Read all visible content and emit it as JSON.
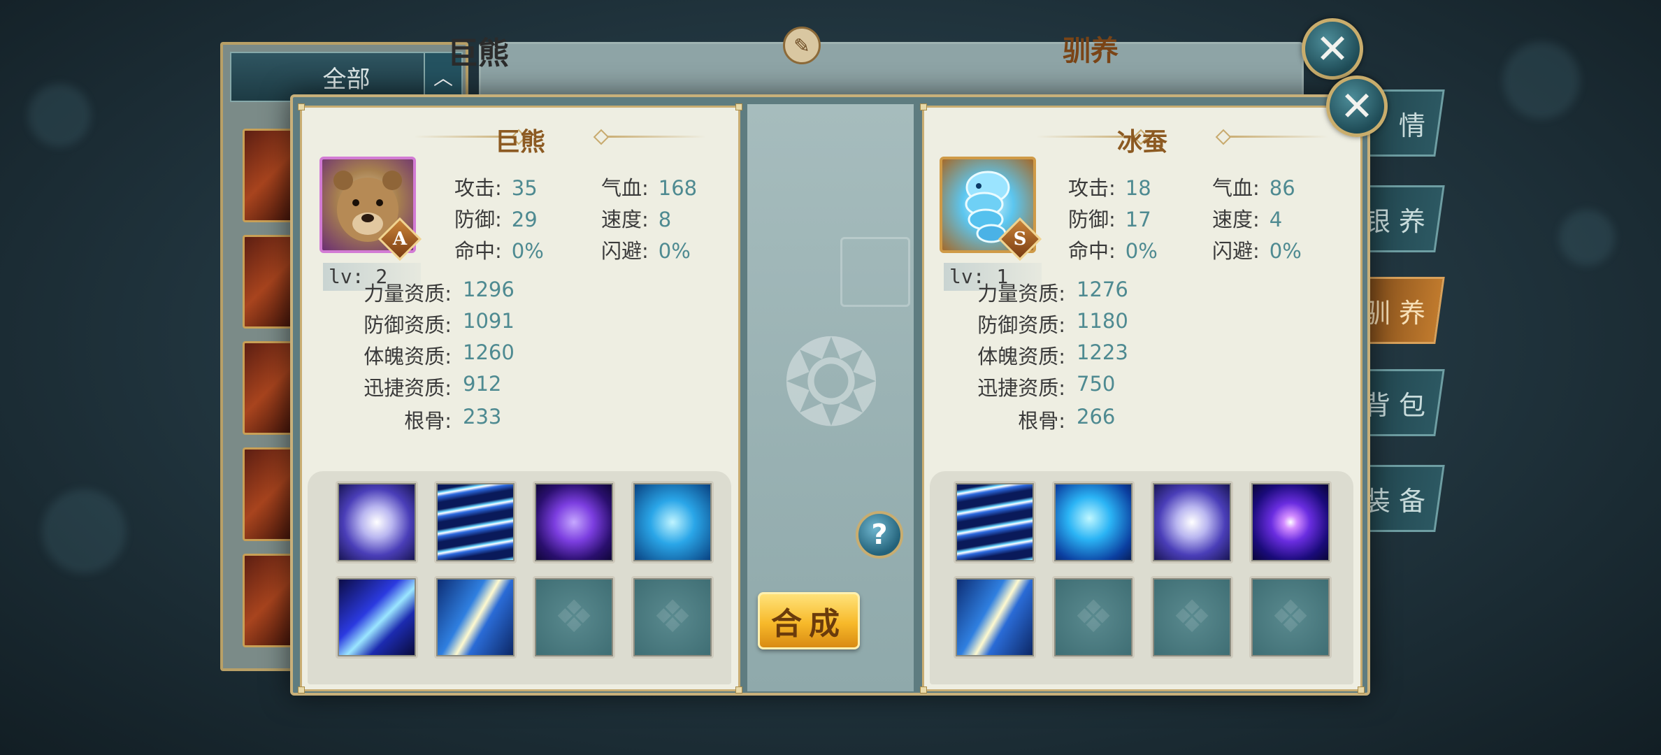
{
  "background_window": {
    "filter_label": "全部",
    "filter_arrow": "︿",
    "center_title": "巨熊",
    "train_title": "驯养",
    "side_tabs": [
      "情",
      "银 养",
      "驯 养",
      "背 包",
      "装 备"
    ]
  },
  "close_label": "✕",
  "left_pet": {
    "name": "巨熊",
    "grade": "A",
    "level": "lv: 2",
    "stats": {
      "attack_label": "攻击:",
      "attack": "35",
      "hp_label": "气血:",
      "hp": "168",
      "defense_label": "防御:",
      "defense": "29",
      "speed_label": "速度:",
      "speed": "8",
      "hit_label": "命中:",
      "hit": "0%",
      "dodge_label": "闪避:",
      "dodge": "0%"
    },
    "aptitudes": {
      "strength_label": "力量资质:",
      "strength": "1296",
      "defense_label": "防御资质:",
      "defense": "1091",
      "constitution_label": "体魄资质:",
      "constitution": "1260",
      "agility_label": "迅捷资质:",
      "agility": "912",
      "root_label": "根骨:",
      "root": "233"
    },
    "skills": [
      "orb",
      "beams",
      "pillar",
      "chain",
      "claw",
      "lightning",
      "empty",
      "empty"
    ]
  },
  "right_pet": {
    "name": "冰蚕",
    "grade": "S",
    "level": "lv: 1",
    "stats": {
      "attack_label": "攻击:",
      "attack": "18",
      "hp_label": "气血:",
      "hp": "86",
      "defense_label": "防御:",
      "defense": "17",
      "speed_label": "速度:",
      "speed": "4",
      "hit_label": "命中:",
      "hit": "0%",
      "dodge_label": "闪避:",
      "dodge": "0%"
    },
    "aptitudes": {
      "strength_label": "力量资质:",
      "strength": "1276",
      "defense_label": "防御资质:",
      "defense": "1180",
      "constitution_label": "体魄资质:",
      "constitution": "1223",
      "agility_label": "迅捷资质:",
      "agility": "750",
      "root_label": "根骨:",
      "root": "266"
    },
    "skills": [
      "beams",
      "wolf",
      "orb",
      "vortex",
      "lightning",
      "empty",
      "empty",
      "empty"
    ]
  },
  "help_label": "?",
  "merge_label": "合成",
  "colors": {
    "accent_gold": "#c9ad72",
    "value_teal": "#4e8a91",
    "title_brown": "#8c5a22"
  }
}
